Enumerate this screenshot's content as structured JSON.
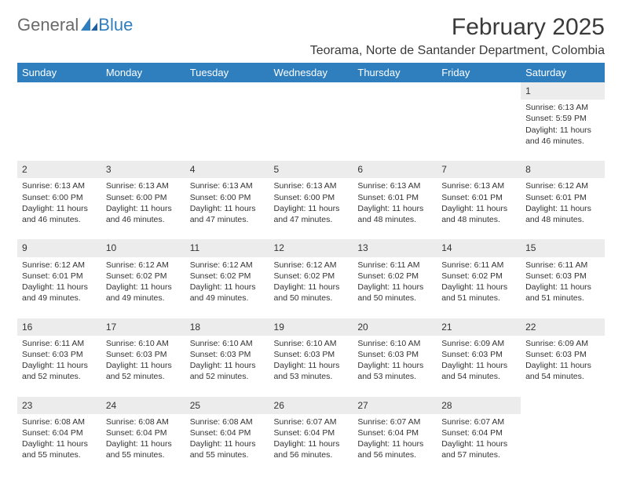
{
  "logo": {
    "text1": "General",
    "text2": "Blue"
  },
  "title": "February 2025",
  "subtitle": "Teorama, Norte de Santander Department, Colombia",
  "day_headers": [
    "Sunday",
    "Monday",
    "Tuesday",
    "Wednesday",
    "Thursday",
    "Friday",
    "Saturday"
  ],
  "chart_data": {
    "type": "table",
    "title": "Sunrise/Sunset calendar — February 2025, Teorama, Norte de Santander Department, Colombia",
    "columns": [
      "day",
      "sunrise",
      "sunset",
      "daylight_hours",
      "daylight_minutes"
    ],
    "rows": [
      {
        "day": 1,
        "sunrise": "6:13 AM",
        "sunset": "5:59 PM",
        "daylight_hours": 11,
        "daylight_minutes": 46
      },
      {
        "day": 2,
        "sunrise": "6:13 AM",
        "sunset": "6:00 PM",
        "daylight_hours": 11,
        "daylight_minutes": 46
      },
      {
        "day": 3,
        "sunrise": "6:13 AM",
        "sunset": "6:00 PM",
        "daylight_hours": 11,
        "daylight_minutes": 46
      },
      {
        "day": 4,
        "sunrise": "6:13 AM",
        "sunset": "6:00 PM",
        "daylight_hours": 11,
        "daylight_minutes": 47
      },
      {
        "day": 5,
        "sunrise": "6:13 AM",
        "sunset": "6:00 PM",
        "daylight_hours": 11,
        "daylight_minutes": 47
      },
      {
        "day": 6,
        "sunrise": "6:13 AM",
        "sunset": "6:01 PM",
        "daylight_hours": 11,
        "daylight_minutes": 48
      },
      {
        "day": 7,
        "sunrise": "6:13 AM",
        "sunset": "6:01 PM",
        "daylight_hours": 11,
        "daylight_minutes": 48
      },
      {
        "day": 8,
        "sunrise": "6:12 AM",
        "sunset": "6:01 PM",
        "daylight_hours": 11,
        "daylight_minutes": 48
      },
      {
        "day": 9,
        "sunrise": "6:12 AM",
        "sunset": "6:01 PM",
        "daylight_hours": 11,
        "daylight_minutes": 49
      },
      {
        "day": 10,
        "sunrise": "6:12 AM",
        "sunset": "6:02 PM",
        "daylight_hours": 11,
        "daylight_minutes": 49
      },
      {
        "day": 11,
        "sunrise": "6:12 AM",
        "sunset": "6:02 PM",
        "daylight_hours": 11,
        "daylight_minutes": 49
      },
      {
        "day": 12,
        "sunrise": "6:12 AM",
        "sunset": "6:02 PM",
        "daylight_hours": 11,
        "daylight_minutes": 50
      },
      {
        "day": 13,
        "sunrise": "6:11 AM",
        "sunset": "6:02 PM",
        "daylight_hours": 11,
        "daylight_minutes": 50
      },
      {
        "day": 14,
        "sunrise": "6:11 AM",
        "sunset": "6:02 PM",
        "daylight_hours": 11,
        "daylight_minutes": 51
      },
      {
        "day": 15,
        "sunrise": "6:11 AM",
        "sunset": "6:03 PM",
        "daylight_hours": 11,
        "daylight_minutes": 51
      },
      {
        "day": 16,
        "sunrise": "6:11 AM",
        "sunset": "6:03 PM",
        "daylight_hours": 11,
        "daylight_minutes": 52
      },
      {
        "day": 17,
        "sunrise": "6:10 AM",
        "sunset": "6:03 PM",
        "daylight_hours": 11,
        "daylight_minutes": 52
      },
      {
        "day": 18,
        "sunrise": "6:10 AM",
        "sunset": "6:03 PM",
        "daylight_hours": 11,
        "daylight_minutes": 52
      },
      {
        "day": 19,
        "sunrise": "6:10 AM",
        "sunset": "6:03 PM",
        "daylight_hours": 11,
        "daylight_minutes": 53
      },
      {
        "day": 20,
        "sunrise": "6:10 AM",
        "sunset": "6:03 PM",
        "daylight_hours": 11,
        "daylight_minutes": 53
      },
      {
        "day": 21,
        "sunrise": "6:09 AM",
        "sunset": "6:03 PM",
        "daylight_hours": 11,
        "daylight_minutes": 54
      },
      {
        "day": 22,
        "sunrise": "6:09 AM",
        "sunset": "6:03 PM",
        "daylight_hours": 11,
        "daylight_minutes": 54
      },
      {
        "day": 23,
        "sunrise": "6:08 AM",
        "sunset": "6:04 PM",
        "daylight_hours": 11,
        "daylight_minutes": 55
      },
      {
        "day": 24,
        "sunrise": "6:08 AM",
        "sunset": "6:04 PM",
        "daylight_hours": 11,
        "daylight_minutes": 55
      },
      {
        "day": 25,
        "sunrise": "6:08 AM",
        "sunset": "6:04 PM",
        "daylight_hours": 11,
        "daylight_minutes": 55
      },
      {
        "day": 26,
        "sunrise": "6:07 AM",
        "sunset": "6:04 PM",
        "daylight_hours": 11,
        "daylight_minutes": 56
      },
      {
        "day": 27,
        "sunrise": "6:07 AM",
        "sunset": "6:04 PM",
        "daylight_hours": 11,
        "daylight_minutes": 56
      },
      {
        "day": 28,
        "sunrise": "6:07 AM",
        "sunset": "6:04 PM",
        "daylight_hours": 11,
        "daylight_minutes": 57
      }
    ]
  },
  "labels": {
    "sunrise": "Sunrise:",
    "sunset": "Sunset:",
    "daylight_prefix": "Daylight:",
    "hours": "hours",
    "and": "and",
    "minutes": "minutes."
  },
  "first_weekday_index": 6
}
